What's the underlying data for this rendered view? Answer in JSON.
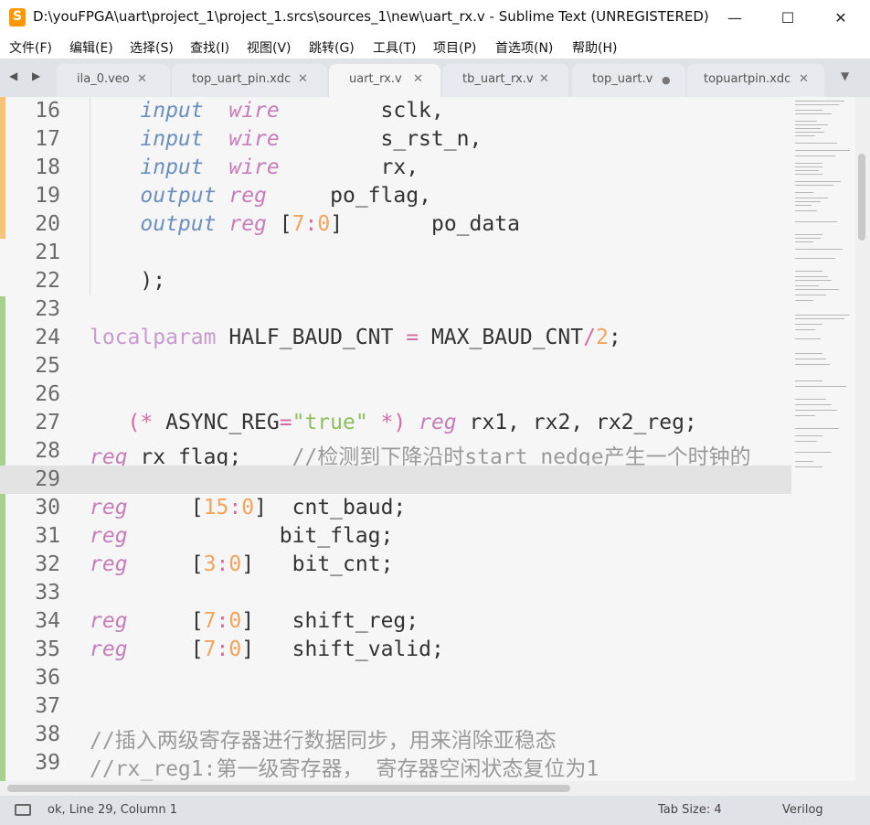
{
  "window": {
    "title": "D:\\youFPGA\\uart\\project_1\\project_1.srcs\\sources_1\\new\\uart_rx.v - Sublime Text (UNREGISTERED)",
    "minimize": "—",
    "maximize": "☐",
    "close": "✕"
  },
  "menu": [
    "文件(F)",
    "编辑(E)",
    "选择(S)",
    "查找(I)",
    "视图(V)",
    "跳转(G)",
    "工具(T)",
    "项目(P)",
    "首选项(N)",
    "帮助(H)"
  ],
  "tabs": [
    {
      "label": "ila_0.veo",
      "close": "✕"
    },
    {
      "label": "top_uart_pin.xdc",
      "close": "✕"
    },
    {
      "label": "uart_rx.v",
      "close": "✕"
    },
    {
      "label": "tb_uart_rx.v",
      "close": "✕"
    },
    {
      "label": "top_uart.v",
      "close": "●"
    },
    {
      "label": "topuartpin.xdc",
      "close": "✕"
    }
  ],
  "tab_nav": "◀ ▶",
  "tab_overflow": "▼",
  "editor": {
    "lines": [
      {
        "n": "16"
      },
      {
        "n": "17"
      },
      {
        "n": "18"
      },
      {
        "n": "19"
      },
      {
        "n": "20"
      },
      {
        "n": "21"
      },
      {
        "n": "22"
      },
      {
        "n": "23"
      },
      {
        "n": "24"
      },
      {
        "n": "25"
      },
      {
        "n": "26"
      },
      {
        "n": "27"
      },
      {
        "n": "28"
      },
      {
        "n": "29"
      },
      {
        "n": "30"
      },
      {
        "n": "31"
      },
      {
        "n": "32"
      },
      {
        "n": "33"
      },
      {
        "n": "34"
      },
      {
        "n": "35"
      },
      {
        "n": "36"
      },
      {
        "n": "37"
      },
      {
        "n": "38"
      },
      {
        "n": "39"
      }
    ],
    "code": {
      "l16": [
        "input",
        "wire",
        "sclk,"
      ],
      "l17": [
        "input",
        "wire",
        "s_rst_n,"
      ],
      "l18": [
        "input",
        "wire",
        "rx,"
      ],
      "l19": [
        "output",
        "reg",
        "po_flag,"
      ],
      "l20": [
        "output",
        "reg",
        "[",
        "7",
        ":",
        "0",
        "]",
        "po_data"
      ],
      "l22": ");",
      "l24": [
        "localparam",
        "HALF_BAUD_CNT",
        "=",
        "MAX_BAUD_CNT",
        "/",
        "2",
        ";"
      ],
      "l27": [
        "(*",
        "ASYNC_REG",
        "=",
        "\"true\"",
        "*)",
        "reg",
        "rx1, rx2, rx2_reg;"
      ],
      "l28": [
        "reg",
        "rx_flag;",
        "//检测到下降沿时start_nedge产生一个时钟的"
      ],
      "l30": [
        "reg",
        "[",
        "15",
        ":",
        "0",
        "]",
        "cnt_baud;"
      ],
      "l31": [
        "reg",
        "bit_flag;"
      ],
      "l32": [
        "reg",
        "[",
        "3",
        ":",
        "0",
        "]",
        "bit_cnt;"
      ],
      "l34": [
        "reg",
        "[",
        "7",
        ":",
        "0",
        "]",
        "shift_reg;"
      ],
      "l35": [
        "reg",
        "[",
        "7",
        ":",
        "0",
        "]",
        "shift_valid;"
      ],
      "l38": "//插入两级寄存器进行数据同步，用来消除亚稳态",
      "l39": "//rx_reg1:第一级寄存器， 寄存器空闲状态复位为1"
    }
  },
  "status": {
    "message": "ok, Line 29, Column 1",
    "tab_size": "Tab Size: 4",
    "syntax": "Verilog"
  },
  "colors": {
    "keyword": "#6b8fbf",
    "type": "#c77dba",
    "number": "#f5a35a",
    "string": "#8fbf5c",
    "comment": "#9a9a9a",
    "gutter_modified": "#f5c27a",
    "gutter_added": "#a9d18e"
  }
}
